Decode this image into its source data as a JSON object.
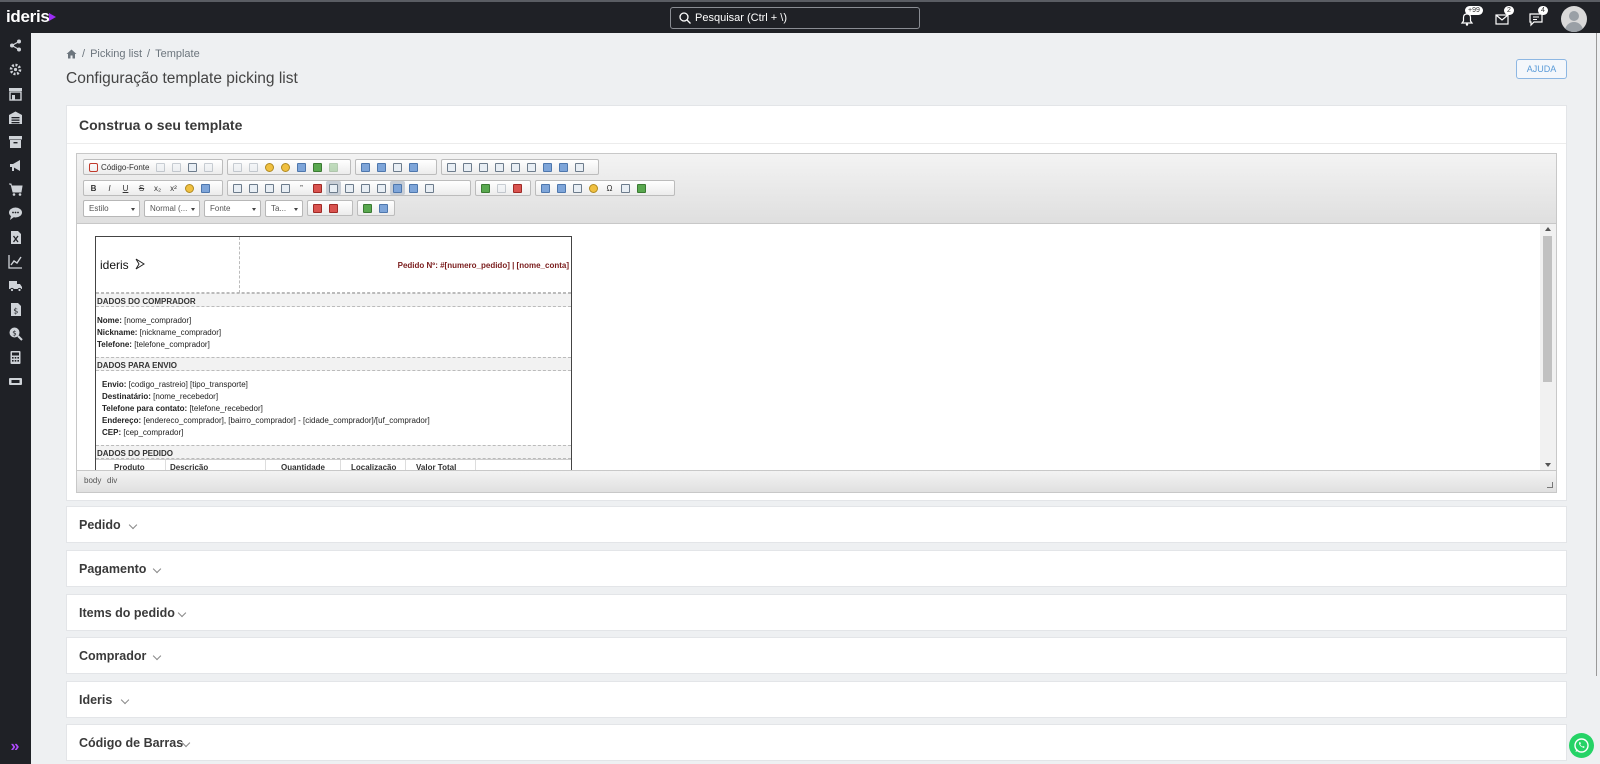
{
  "app": {
    "logo_text": "ideris",
    "brand_color": "#9b2df5"
  },
  "search": {
    "placeholder": "Pesquisar (Ctrl + \\)"
  },
  "notifications": {
    "bell_badge": "+99",
    "mail_badge": "2",
    "chat_badge": "4"
  },
  "sidebar": {
    "items": [
      {
        "icon": "share-icon"
      },
      {
        "icon": "gear-icon"
      },
      {
        "icon": "store-icon"
      },
      {
        "icon": "warehouse-icon"
      },
      {
        "icon": "archive-box-icon"
      },
      {
        "icon": "megaphone-icon"
      },
      {
        "icon": "cart-icon"
      },
      {
        "icon": "chat-bubble-icon"
      },
      {
        "icon": "excel-file-icon"
      },
      {
        "icon": "line-chart-icon"
      },
      {
        "icon": "truck-icon"
      },
      {
        "icon": "invoice-icon"
      },
      {
        "icon": "search-dollar-icon"
      },
      {
        "icon": "calculator-icon"
      },
      {
        "icon": "ticket-icon"
      }
    ],
    "expand_icon": "double-chevron-right-icon"
  },
  "breadcrumb": {
    "home_icon": "home-icon",
    "items": [
      "Picking list",
      "Template"
    ]
  },
  "page": {
    "title": "Configuração template picking list",
    "help_label": "AJUDA"
  },
  "card": {
    "title": "Construa o seu template"
  },
  "editor": {
    "source_label": "Código-Fonte",
    "combos": {
      "style": "Estilo",
      "format": "Normal (...",
      "font": "Fonte",
      "size": "Ta..."
    },
    "status_path": [
      "body",
      "div"
    ]
  },
  "template": {
    "logo_text": "ideris",
    "order_line": "Pedido Nº: #[numero_pedido] | [nome_conta]",
    "sections": {
      "buyer": {
        "title": "DADOS DO COMPRADOR",
        "lines": [
          {
            "label": "Nome:",
            "value": "[nome_comprador]"
          },
          {
            "label": "Nickname:",
            "value": "[nickname_comprador]"
          },
          {
            "label": "Telefone:",
            "value": "[telefone_comprador]"
          }
        ]
      },
      "shipping": {
        "title": "DADOS PARA ENVIO",
        "lines": [
          {
            "label": "Envio:",
            "value": "[codigo_rastreio] [tipo_transporte]"
          },
          {
            "label": "Destinatário:",
            "value": " [nome_recebedor]"
          },
          {
            "label": "Telefone para contato:",
            "value": "[telefone_recebedor]"
          },
          {
            "label": "Endereço:",
            "value": "[endereco_comprador], [bairro_comprador] - [cidade_comprador]/[uf_comprador]"
          },
          {
            "label": "CEP:",
            "value": "[cep_comprador]"
          }
        ]
      },
      "order": {
        "title": "DADOS DO PEDIDO",
        "columns": [
          "Produto",
          "Descrição",
          "Quantidade",
          "Localização",
          "Valor Total"
        ]
      }
    }
  },
  "accordions": [
    {
      "label": "Pedido"
    },
    {
      "label": "Pagamento"
    },
    {
      "label": "Items do pedido"
    },
    {
      "label": "Comprador"
    },
    {
      "label": "Ideris"
    },
    {
      "label": "Código de Barras"
    }
  ],
  "whatsapp_icon": "whatsapp-icon"
}
